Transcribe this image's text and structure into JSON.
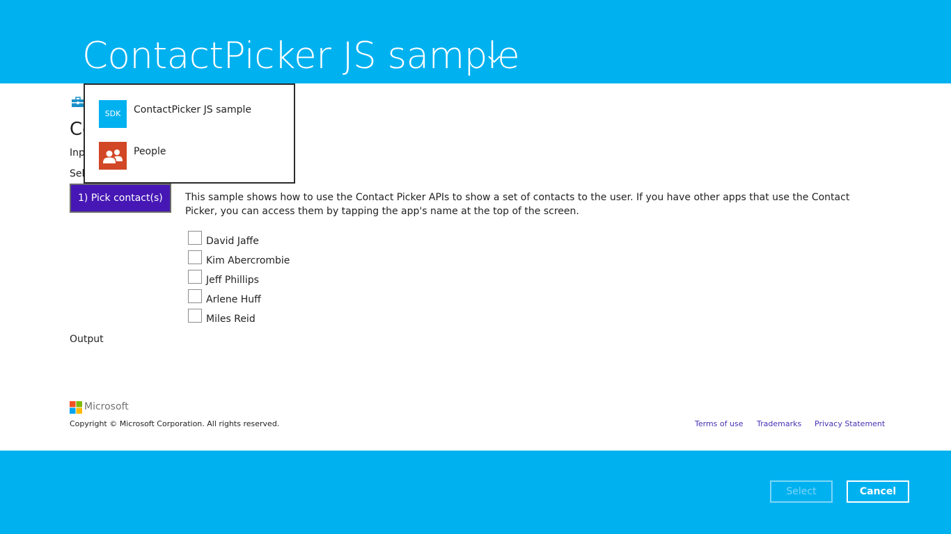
{
  "header": {
    "title": "ContactPicker JS sample"
  },
  "page": {
    "heading_partial": "Co",
    "input_partial": "Inp",
    "select_partial": "Sel"
  },
  "scenario_button": {
    "label": "1) Pick contact(s)"
  },
  "description": "This sample shows how to use the Contact Picker APIs to show a set of contacts to the user. If you have other apps that use the Contact Picker, you can access them by tapping the app's name at the top of the screen.",
  "contacts": [
    {
      "name": "David Jaffe"
    },
    {
      "name": "Kim Abercrombie"
    },
    {
      "name": "Jeff Phillips"
    },
    {
      "name": "Arlene Huff"
    },
    {
      "name": "Miles Reid"
    }
  ],
  "output_label": "Output",
  "footer_info": {
    "brand": "Microsoft",
    "copyright": "Copyright © Microsoft Corporation. All rights reserved.",
    "links": [
      "Terms of use",
      "Trademarks",
      "Privacy Statement"
    ]
  },
  "app_switcher": {
    "items": [
      {
        "label": "ContactPicker JS sample",
        "tile_text": "SDK",
        "tile_color": "#00b1f0"
      },
      {
        "label": "People",
        "tile_text": "",
        "tile_color": "#d24726"
      }
    ]
  },
  "actions": {
    "select_label": "Select",
    "cancel_label": "Cancel"
  },
  "colors": {
    "accent": "#00b1f0",
    "button": "#4617b4",
    "link": "#4a2fb4"
  }
}
